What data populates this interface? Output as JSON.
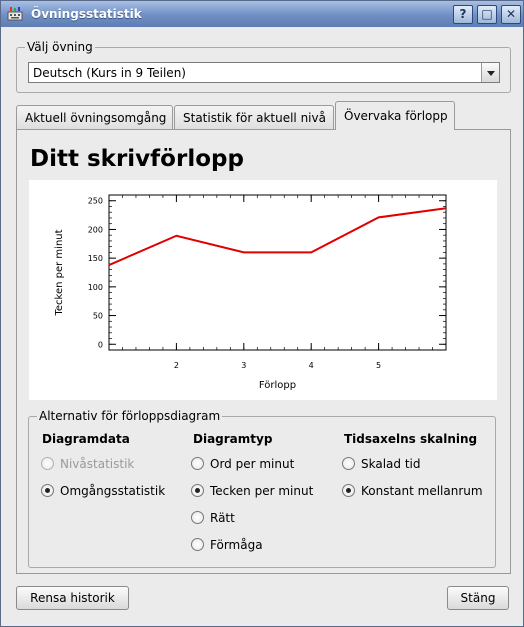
{
  "window": {
    "title": "Övningsstatistik",
    "buttons": [
      "?",
      "□",
      "✕"
    ]
  },
  "exercise_group": {
    "title": "Välj övning",
    "selected": "Deutsch (Kurs in 9 Teilen)"
  },
  "tabs": [
    {
      "label": "Aktuell övningsomgång",
      "active": false
    },
    {
      "label": "Statistik för aktuell nivå",
      "active": false
    },
    {
      "label": "Övervaka förlopp",
      "active": true
    }
  ],
  "panel": {
    "heading": "Ditt skrivförlopp"
  },
  "chart_data": {
    "type": "line",
    "xlabel": "Förlopp",
    "ylabel": "Tecken per minut",
    "x": [
      1,
      2,
      3,
      4,
      5,
      6
    ],
    "x_ticks": [
      2,
      3,
      4,
      5
    ],
    "y_ticks": [
      0,
      50,
      100,
      150,
      200,
      250
    ],
    "xlim": [
      1,
      6
    ],
    "ylim": [
      -10,
      260
    ],
    "series": [
      {
        "values": [
          138,
          189,
          160,
          160,
          221,
          237
        ],
        "color": "#e00000"
      }
    ],
    "grid": false
  },
  "options": {
    "title": "Alternativ för förloppsdiagram",
    "col1": {
      "heading": "Diagramdata",
      "items": [
        {
          "label": "Nivåstatistik",
          "checked": false,
          "disabled": true
        },
        {
          "label": "Omgångsstatistik",
          "checked": true,
          "disabled": false
        }
      ]
    },
    "col2": {
      "heading": "Diagramtyp",
      "items": [
        {
          "label": "Ord per minut",
          "checked": false
        },
        {
          "label": "Tecken per minut",
          "checked": true
        },
        {
          "label": "Rätt",
          "checked": false
        },
        {
          "label": "Förmåga",
          "checked": false
        }
      ]
    },
    "col3": {
      "heading": "Tidsaxelns skalning",
      "items": [
        {
          "label": "Skalad tid",
          "checked": false
        },
        {
          "label": "Konstant mellanrum",
          "checked": true
        }
      ]
    }
  },
  "footer": {
    "clear_label": "Rensa historik",
    "close_label": "Stäng"
  }
}
